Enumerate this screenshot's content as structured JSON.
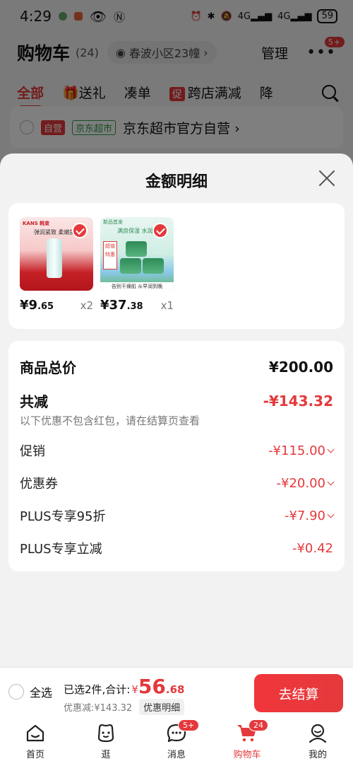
{
  "status_bar": {
    "time": "4:29",
    "battery": "59"
  },
  "header": {
    "title": "购物车",
    "count": "(24)",
    "address": "春波小区23幢",
    "manage": "管理",
    "more_badge": "5+"
  },
  "tabs": {
    "all": "全部",
    "gift": "送礼",
    "combine": "凑单",
    "promo_badge": "促",
    "cross_store": "跨店满减",
    "drop": "降"
  },
  "store_row": {
    "tag1": "自营",
    "tag2": "京东超市",
    "name": "京东超市官方自营 ›"
  },
  "sheet": {
    "title": "金额明细",
    "products": [
      {
        "brand": "KANS 韩束",
        "slogan": "弹润紧致 柔嫩提",
        "price_int": "¥9",
        "price_dec": ".65",
        "qty": "x2"
      },
      {
        "brand": "新品首发",
        "slogan": "满良保湿 水润",
        "badge": "超值特惠",
        "footer": "告别干燥肌 从早润到晚",
        "price_int": "¥37",
        "price_dec": ".38",
        "qty": "x1"
      }
    ],
    "details": {
      "total_label": "商品总价",
      "total_value": "¥200.00",
      "reduce_label": "共减",
      "reduce_value": "-¥143.32",
      "reduce_note": "以下优惠不包含红包，请在结算页查看",
      "rows": [
        {
          "label": "促销",
          "value": "-¥115.00"
        },
        {
          "label": "优惠券",
          "value": "-¥20.00"
        },
        {
          "label": "PLUS专享95折",
          "value": "-¥7.90"
        },
        {
          "label": "PLUS专享立减",
          "value": "-¥0.42"
        }
      ]
    }
  },
  "checkout": {
    "select_all": "全选",
    "summary_label": "已选2件,合计:",
    "currency": "¥",
    "total_int": "56",
    "total_dec": ".68",
    "discount_text": "优惠减:¥143.32",
    "discount_detail": "优惠明细",
    "button": "去结算"
  },
  "nav": {
    "items": [
      {
        "label": "首页",
        "icon": "home-icon"
      },
      {
        "label": "逛",
        "icon": "browse-icon"
      },
      {
        "label": "消息",
        "icon": "message-icon",
        "badge": "5+"
      },
      {
        "label": "购物车",
        "icon": "cart-icon",
        "badge": "24"
      },
      {
        "label": "我的",
        "icon": "profile-icon"
      }
    ]
  },
  "colors": {
    "accent": "#e4393c",
    "sheet_bg": "#f2f2f2"
  }
}
